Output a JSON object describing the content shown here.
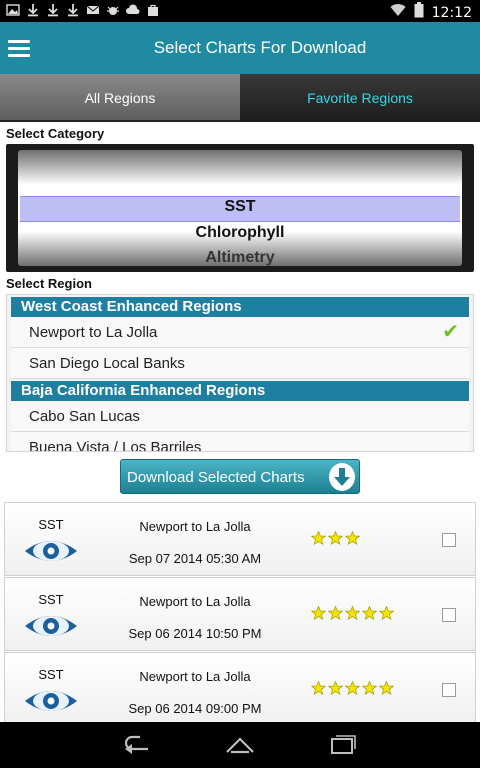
{
  "statusbar": {
    "time": "12:12",
    "notification_icons": [
      "image-icon",
      "download-icon",
      "download-icon",
      "download-icon",
      "mail-icon",
      "bug-icon",
      "cloud-icon",
      "bag-icon"
    ]
  },
  "actionbar": {
    "title": "Select Charts For Download"
  },
  "tabs": {
    "all": "All Regions",
    "favorite": "Favorite Regions"
  },
  "category": {
    "label": "Select Category",
    "items": [
      "SST",
      "Chlorophyll",
      "Altimetry"
    ],
    "selected": "SST"
  },
  "region": {
    "label": "Select Region",
    "groups": [
      {
        "header": "West Coast Enhanced Regions",
        "items": [
          {
            "name": "Newport to La Jolla",
            "checked": true
          },
          {
            "name": "San Diego Local Banks",
            "checked": false
          }
        ]
      },
      {
        "header": "Baja California Enhanced Regions",
        "items": [
          {
            "name": "Cabo San Lucas",
            "checked": false
          },
          {
            "name": "Buena Vista / Los Barriles",
            "checked": false
          }
        ]
      }
    ]
  },
  "download_button": {
    "label": "Download Selected Charts"
  },
  "charts": [
    {
      "category": "SST",
      "region": "Newport to La Jolla",
      "date": "Sep 07 2014 05:30 AM",
      "stars": 3,
      "checked": false
    },
    {
      "category": "SST",
      "region": "Newport to La Jolla",
      "date": "Sep 06 2014 10:50 PM",
      "stars": 5,
      "checked": false
    },
    {
      "category": "SST",
      "region": "Newport to La Jolla",
      "date": "Sep 06 2014 09:00 PM",
      "stars": 5,
      "checked": false
    }
  ],
  "colors": {
    "actionbar": "#1f8aa1",
    "accent_tab": "#38d6e6",
    "region_header": "#1f7fa0",
    "check": "#6bc31f",
    "star": "#f2e600",
    "eye": "#1c5f9e"
  }
}
